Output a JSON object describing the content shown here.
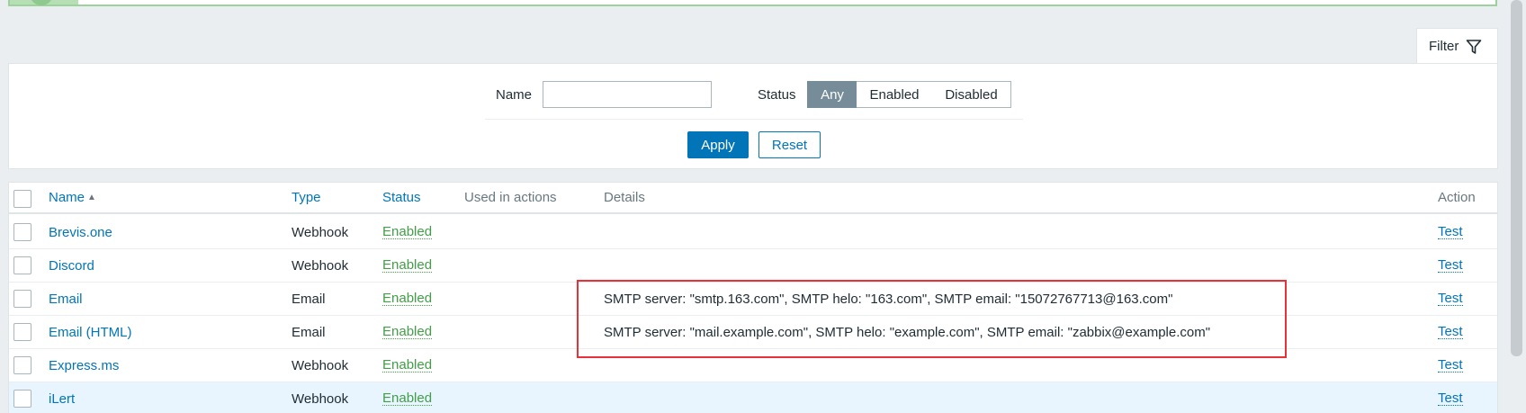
{
  "filter": {
    "tab_label": "Filter",
    "tab_icon": "funnel-icon",
    "name_label": "Name",
    "name_value": "",
    "status_label": "Status",
    "status_options": [
      "Any",
      "Enabled",
      "Disabled"
    ],
    "status_selected": "Any",
    "apply_label": "Apply",
    "reset_label": "Reset"
  },
  "table": {
    "columns": {
      "name": "Name",
      "name_sort_indicator": "▲",
      "type": "Type",
      "status": "Status",
      "used_in_actions": "Used in actions",
      "details": "Details",
      "action": "Action"
    },
    "rows": [
      {
        "name": "Brevis.one",
        "type": "Webhook",
        "status": "Enabled",
        "used_in_actions": "",
        "details": "",
        "action": "Test"
      },
      {
        "name": "Discord",
        "type": "Webhook",
        "status": "Enabled",
        "used_in_actions": "",
        "details": "",
        "action": "Test"
      },
      {
        "name": "Email",
        "type": "Email",
        "status": "Enabled",
        "used_in_actions": "",
        "details": "SMTP server: \"smtp.163.com\", SMTP helo: \"163.com\", SMTP email: \"15072767713@163.com\"",
        "action": "Test"
      },
      {
        "name": "Email (HTML)",
        "type": "Email",
        "status": "Enabled",
        "used_in_actions": "",
        "details": "SMTP server: \"mail.example.com\", SMTP helo: \"example.com\", SMTP email: \"zabbix@example.com\"",
        "action": "Test"
      },
      {
        "name": "Express.ms",
        "type": "Webhook",
        "status": "Enabled",
        "used_in_actions": "",
        "details": "",
        "action": "Test"
      },
      {
        "name": "iLert",
        "type": "Webhook",
        "status": "Enabled",
        "used_in_actions": "",
        "details": "",
        "action": "Test"
      }
    ]
  },
  "colors": {
    "accent": "#0275b8",
    "enabled_green": "#429e47",
    "highlight_red": "#e8323a",
    "selected_segment": "#768d99"
  }
}
